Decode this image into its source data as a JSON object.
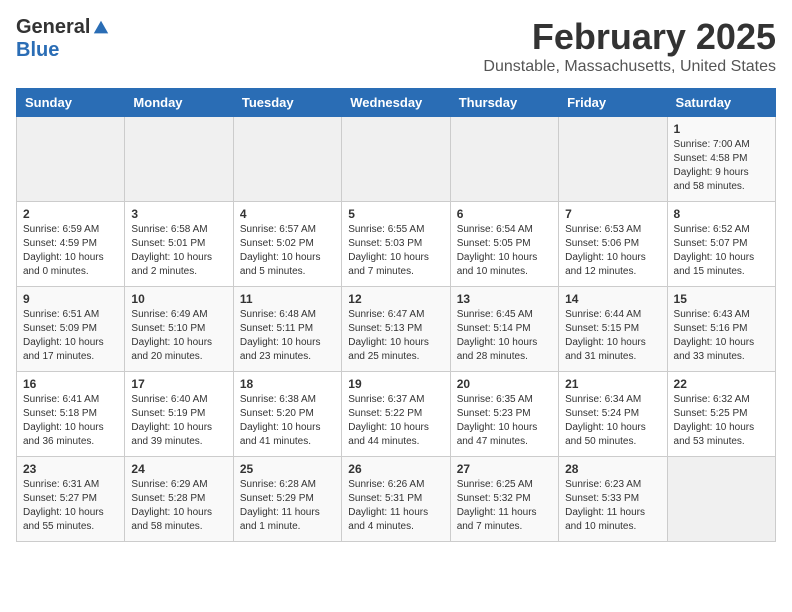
{
  "header": {
    "logo_general": "General",
    "logo_blue": "Blue",
    "title": "February 2025",
    "subtitle": "Dunstable, Massachusetts, United States"
  },
  "days_of_week": [
    "Sunday",
    "Monday",
    "Tuesday",
    "Wednesday",
    "Thursday",
    "Friday",
    "Saturday"
  ],
  "weeks": [
    [
      {
        "day": "",
        "info": ""
      },
      {
        "day": "",
        "info": ""
      },
      {
        "day": "",
        "info": ""
      },
      {
        "day": "",
        "info": ""
      },
      {
        "day": "",
        "info": ""
      },
      {
        "day": "",
        "info": ""
      },
      {
        "day": "1",
        "info": "Sunrise: 7:00 AM\nSunset: 4:58 PM\nDaylight: 9 hours\nand 58 minutes."
      }
    ],
    [
      {
        "day": "2",
        "info": "Sunrise: 6:59 AM\nSunset: 4:59 PM\nDaylight: 10 hours\nand 0 minutes."
      },
      {
        "day": "3",
        "info": "Sunrise: 6:58 AM\nSunset: 5:01 PM\nDaylight: 10 hours\nand 2 minutes."
      },
      {
        "day": "4",
        "info": "Sunrise: 6:57 AM\nSunset: 5:02 PM\nDaylight: 10 hours\nand 5 minutes."
      },
      {
        "day": "5",
        "info": "Sunrise: 6:55 AM\nSunset: 5:03 PM\nDaylight: 10 hours\nand 7 minutes."
      },
      {
        "day": "6",
        "info": "Sunrise: 6:54 AM\nSunset: 5:05 PM\nDaylight: 10 hours\nand 10 minutes."
      },
      {
        "day": "7",
        "info": "Sunrise: 6:53 AM\nSunset: 5:06 PM\nDaylight: 10 hours\nand 12 minutes."
      },
      {
        "day": "8",
        "info": "Sunrise: 6:52 AM\nSunset: 5:07 PM\nDaylight: 10 hours\nand 15 minutes."
      }
    ],
    [
      {
        "day": "9",
        "info": "Sunrise: 6:51 AM\nSunset: 5:09 PM\nDaylight: 10 hours\nand 17 minutes."
      },
      {
        "day": "10",
        "info": "Sunrise: 6:49 AM\nSunset: 5:10 PM\nDaylight: 10 hours\nand 20 minutes."
      },
      {
        "day": "11",
        "info": "Sunrise: 6:48 AM\nSunset: 5:11 PM\nDaylight: 10 hours\nand 23 minutes."
      },
      {
        "day": "12",
        "info": "Sunrise: 6:47 AM\nSunset: 5:13 PM\nDaylight: 10 hours\nand 25 minutes."
      },
      {
        "day": "13",
        "info": "Sunrise: 6:45 AM\nSunset: 5:14 PM\nDaylight: 10 hours\nand 28 minutes."
      },
      {
        "day": "14",
        "info": "Sunrise: 6:44 AM\nSunset: 5:15 PM\nDaylight: 10 hours\nand 31 minutes."
      },
      {
        "day": "15",
        "info": "Sunrise: 6:43 AM\nSunset: 5:16 PM\nDaylight: 10 hours\nand 33 minutes."
      }
    ],
    [
      {
        "day": "16",
        "info": "Sunrise: 6:41 AM\nSunset: 5:18 PM\nDaylight: 10 hours\nand 36 minutes."
      },
      {
        "day": "17",
        "info": "Sunrise: 6:40 AM\nSunset: 5:19 PM\nDaylight: 10 hours\nand 39 minutes."
      },
      {
        "day": "18",
        "info": "Sunrise: 6:38 AM\nSunset: 5:20 PM\nDaylight: 10 hours\nand 41 minutes."
      },
      {
        "day": "19",
        "info": "Sunrise: 6:37 AM\nSunset: 5:22 PM\nDaylight: 10 hours\nand 44 minutes."
      },
      {
        "day": "20",
        "info": "Sunrise: 6:35 AM\nSunset: 5:23 PM\nDaylight: 10 hours\nand 47 minutes."
      },
      {
        "day": "21",
        "info": "Sunrise: 6:34 AM\nSunset: 5:24 PM\nDaylight: 10 hours\nand 50 minutes."
      },
      {
        "day": "22",
        "info": "Sunrise: 6:32 AM\nSunset: 5:25 PM\nDaylight: 10 hours\nand 53 minutes."
      }
    ],
    [
      {
        "day": "23",
        "info": "Sunrise: 6:31 AM\nSunset: 5:27 PM\nDaylight: 10 hours\nand 55 minutes."
      },
      {
        "day": "24",
        "info": "Sunrise: 6:29 AM\nSunset: 5:28 PM\nDaylight: 10 hours\nand 58 minutes."
      },
      {
        "day": "25",
        "info": "Sunrise: 6:28 AM\nSunset: 5:29 PM\nDaylight: 11 hours\nand 1 minute."
      },
      {
        "day": "26",
        "info": "Sunrise: 6:26 AM\nSunset: 5:31 PM\nDaylight: 11 hours\nand 4 minutes."
      },
      {
        "day": "27",
        "info": "Sunrise: 6:25 AM\nSunset: 5:32 PM\nDaylight: 11 hours\nand 7 minutes."
      },
      {
        "day": "28",
        "info": "Sunrise: 6:23 AM\nSunset: 5:33 PM\nDaylight: 11 hours\nand 10 minutes."
      },
      {
        "day": "",
        "info": ""
      }
    ]
  ]
}
